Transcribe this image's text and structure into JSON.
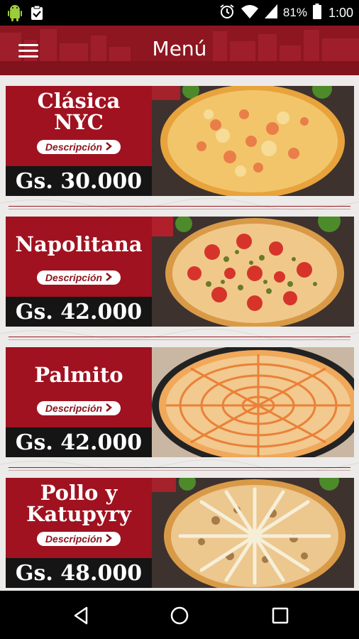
{
  "status_bar": {
    "battery": "81%",
    "time": "1:00",
    "icons": [
      "android-debug-icon",
      "clipboard-check-icon",
      "alarm-icon",
      "wifi-icon",
      "signal-icon",
      "battery-icon"
    ]
  },
  "app_bar": {
    "title": "Menú",
    "menu_icon": "hamburger-menu-icon"
  },
  "menu_items": [
    {
      "name_line1": "Clásica",
      "name_line2": "NYC",
      "description_label": "Descripción",
      "price": "Gs. 30.000",
      "topping": "cheese"
    },
    {
      "name_line1": "Napolitana",
      "name_line2": "",
      "description_label": "Descripción",
      "price": "Gs. 42.000",
      "topping": "tomato-olive"
    },
    {
      "name_line1": "Palmito",
      "name_line2": "",
      "description_label": "Descripción",
      "price": "Gs. 42.000",
      "topping": "sauce-web"
    },
    {
      "name_line1": "Pollo y",
      "name_line2": "Katupyry",
      "description_label": "Descripción",
      "price": "Gs. 48.000",
      "topping": "chicken-cream"
    }
  ],
  "colors": {
    "brand_red": "#a01220",
    "app_bar_red": "#8d1620",
    "price_bar": "#151515",
    "background": "#ecebe9"
  },
  "nav_bar": {
    "icons": [
      "back-icon",
      "home-icon",
      "recents-icon"
    ]
  }
}
